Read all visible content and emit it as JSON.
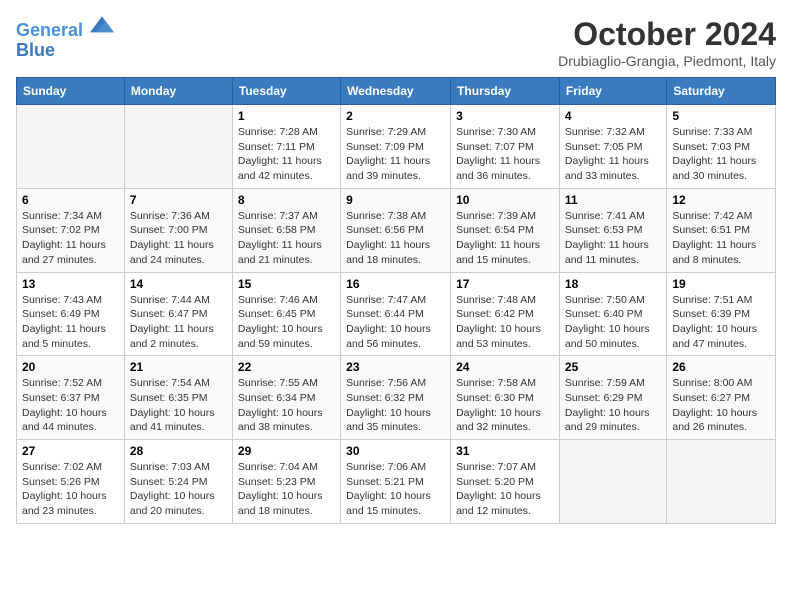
{
  "logo": {
    "line1": "General",
    "line2": "Blue"
  },
  "header": {
    "month": "October 2024",
    "location": "Drubiaglio-Grangia, Piedmont, Italy"
  },
  "days_of_week": [
    "Sunday",
    "Monday",
    "Tuesday",
    "Wednesday",
    "Thursday",
    "Friday",
    "Saturday"
  ],
  "weeks": [
    [
      {
        "day": "",
        "sunrise": "",
        "sunset": "",
        "daylight": "",
        "empty": true
      },
      {
        "day": "",
        "sunrise": "",
        "sunset": "",
        "daylight": "",
        "empty": true
      },
      {
        "day": "1",
        "sunrise": "Sunrise: 7:28 AM",
        "sunset": "Sunset: 7:11 PM",
        "daylight": "Daylight: 11 hours and 42 minutes."
      },
      {
        "day": "2",
        "sunrise": "Sunrise: 7:29 AM",
        "sunset": "Sunset: 7:09 PM",
        "daylight": "Daylight: 11 hours and 39 minutes."
      },
      {
        "day": "3",
        "sunrise": "Sunrise: 7:30 AM",
        "sunset": "Sunset: 7:07 PM",
        "daylight": "Daylight: 11 hours and 36 minutes."
      },
      {
        "day": "4",
        "sunrise": "Sunrise: 7:32 AM",
        "sunset": "Sunset: 7:05 PM",
        "daylight": "Daylight: 11 hours and 33 minutes."
      },
      {
        "day": "5",
        "sunrise": "Sunrise: 7:33 AM",
        "sunset": "Sunset: 7:03 PM",
        "daylight": "Daylight: 11 hours and 30 minutes."
      }
    ],
    [
      {
        "day": "6",
        "sunrise": "Sunrise: 7:34 AM",
        "sunset": "Sunset: 7:02 PM",
        "daylight": "Daylight: 11 hours and 27 minutes."
      },
      {
        "day": "7",
        "sunrise": "Sunrise: 7:36 AM",
        "sunset": "Sunset: 7:00 PM",
        "daylight": "Daylight: 11 hours and 24 minutes."
      },
      {
        "day": "8",
        "sunrise": "Sunrise: 7:37 AM",
        "sunset": "Sunset: 6:58 PM",
        "daylight": "Daylight: 11 hours and 21 minutes."
      },
      {
        "day": "9",
        "sunrise": "Sunrise: 7:38 AM",
        "sunset": "Sunset: 6:56 PM",
        "daylight": "Daylight: 11 hours and 18 minutes."
      },
      {
        "day": "10",
        "sunrise": "Sunrise: 7:39 AM",
        "sunset": "Sunset: 6:54 PM",
        "daylight": "Daylight: 11 hours and 15 minutes."
      },
      {
        "day": "11",
        "sunrise": "Sunrise: 7:41 AM",
        "sunset": "Sunset: 6:53 PM",
        "daylight": "Daylight: 11 hours and 11 minutes."
      },
      {
        "day": "12",
        "sunrise": "Sunrise: 7:42 AM",
        "sunset": "Sunset: 6:51 PM",
        "daylight": "Daylight: 11 hours and 8 minutes."
      }
    ],
    [
      {
        "day": "13",
        "sunrise": "Sunrise: 7:43 AM",
        "sunset": "Sunset: 6:49 PM",
        "daylight": "Daylight: 11 hours and 5 minutes."
      },
      {
        "day": "14",
        "sunrise": "Sunrise: 7:44 AM",
        "sunset": "Sunset: 6:47 PM",
        "daylight": "Daylight: 11 hours and 2 minutes."
      },
      {
        "day": "15",
        "sunrise": "Sunrise: 7:46 AM",
        "sunset": "Sunset: 6:45 PM",
        "daylight": "Daylight: 10 hours and 59 minutes."
      },
      {
        "day": "16",
        "sunrise": "Sunrise: 7:47 AM",
        "sunset": "Sunset: 6:44 PM",
        "daylight": "Daylight: 10 hours and 56 minutes."
      },
      {
        "day": "17",
        "sunrise": "Sunrise: 7:48 AM",
        "sunset": "Sunset: 6:42 PM",
        "daylight": "Daylight: 10 hours and 53 minutes."
      },
      {
        "day": "18",
        "sunrise": "Sunrise: 7:50 AM",
        "sunset": "Sunset: 6:40 PM",
        "daylight": "Daylight: 10 hours and 50 minutes."
      },
      {
        "day": "19",
        "sunrise": "Sunrise: 7:51 AM",
        "sunset": "Sunset: 6:39 PM",
        "daylight": "Daylight: 10 hours and 47 minutes."
      }
    ],
    [
      {
        "day": "20",
        "sunrise": "Sunrise: 7:52 AM",
        "sunset": "Sunset: 6:37 PM",
        "daylight": "Daylight: 10 hours and 44 minutes."
      },
      {
        "day": "21",
        "sunrise": "Sunrise: 7:54 AM",
        "sunset": "Sunset: 6:35 PM",
        "daylight": "Daylight: 10 hours and 41 minutes."
      },
      {
        "day": "22",
        "sunrise": "Sunrise: 7:55 AM",
        "sunset": "Sunset: 6:34 PM",
        "daylight": "Daylight: 10 hours and 38 minutes."
      },
      {
        "day": "23",
        "sunrise": "Sunrise: 7:56 AM",
        "sunset": "Sunset: 6:32 PM",
        "daylight": "Daylight: 10 hours and 35 minutes."
      },
      {
        "day": "24",
        "sunrise": "Sunrise: 7:58 AM",
        "sunset": "Sunset: 6:30 PM",
        "daylight": "Daylight: 10 hours and 32 minutes."
      },
      {
        "day": "25",
        "sunrise": "Sunrise: 7:59 AM",
        "sunset": "Sunset: 6:29 PM",
        "daylight": "Daylight: 10 hours and 29 minutes."
      },
      {
        "day": "26",
        "sunrise": "Sunrise: 8:00 AM",
        "sunset": "Sunset: 6:27 PM",
        "daylight": "Daylight: 10 hours and 26 minutes."
      }
    ],
    [
      {
        "day": "27",
        "sunrise": "Sunrise: 7:02 AM",
        "sunset": "Sunset: 5:26 PM",
        "daylight": "Daylight: 10 hours and 23 minutes."
      },
      {
        "day": "28",
        "sunrise": "Sunrise: 7:03 AM",
        "sunset": "Sunset: 5:24 PM",
        "daylight": "Daylight: 10 hours and 20 minutes."
      },
      {
        "day": "29",
        "sunrise": "Sunrise: 7:04 AM",
        "sunset": "Sunset: 5:23 PM",
        "daylight": "Daylight: 10 hours and 18 minutes."
      },
      {
        "day": "30",
        "sunrise": "Sunrise: 7:06 AM",
        "sunset": "Sunset: 5:21 PM",
        "daylight": "Daylight: 10 hours and 15 minutes."
      },
      {
        "day": "31",
        "sunrise": "Sunrise: 7:07 AM",
        "sunset": "Sunset: 5:20 PM",
        "daylight": "Daylight: 10 hours and 12 minutes."
      },
      {
        "day": "",
        "sunrise": "",
        "sunset": "",
        "daylight": "",
        "empty": true
      },
      {
        "day": "",
        "sunrise": "",
        "sunset": "",
        "daylight": "",
        "empty": true
      }
    ]
  ]
}
